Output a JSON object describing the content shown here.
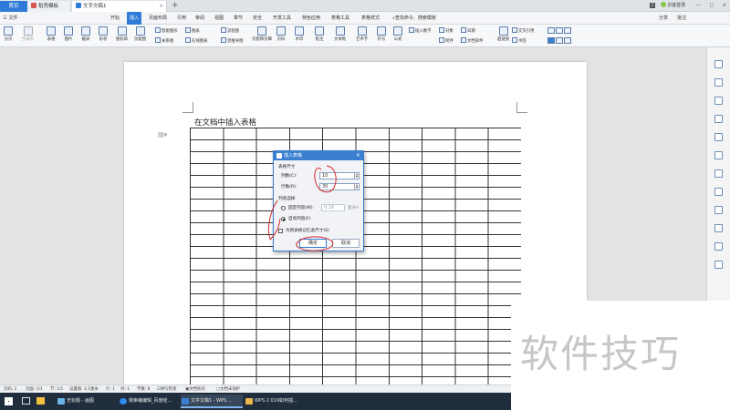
{
  "tabs": [
    {
      "label": "首页"
    },
    {
      "label": "稻壳模板"
    },
    {
      "label": "文字文稿1"
    }
  ],
  "window": {
    "new_tab": "+",
    "login": "访客登录",
    "icon_badge": "1"
  },
  "menu": {
    "file": "三 文件",
    "items": [
      "开始",
      "插入",
      "页面布局",
      "引用",
      "审阅",
      "视图",
      "章节",
      "安全",
      "开发工具",
      "特色应用",
      "表格工具",
      "表格样式"
    ],
    "search": "查找命令、搜索模板",
    "share": "分享",
    "comment": "批注"
  },
  "ribbon": {
    "large": [
      "分页",
      "空白页",
      "表格",
      "图片",
      "截屏",
      "形状",
      "图标库",
      "功能图",
      "页眉和页脚",
      "页码",
      "水印",
      "批注",
      "文本框",
      "艺术字",
      "符号",
      "公式",
      "超链接",
      "书签"
    ],
    "small": [
      "智能图形",
      "关系图",
      "图表",
      "在线图表",
      "流程图",
      "思维导图",
      "插入数字",
      "对象",
      "日期",
      "附件",
      "文档部件",
      "交叉引用"
    ]
  },
  "document": {
    "heading": "在文档中插入表格",
    "table_rows": 22,
    "table_cols": 10
  },
  "dialog": {
    "title": "插入表格",
    "close": "×",
    "size_section": "表格尺寸",
    "cols_label": "列数(C):",
    "cols_value": "10",
    "rows_label": "行数(R):",
    "rows_value": "30",
    "width_section": "列宽选择",
    "fixed_label": "固定列宽(W):",
    "fixed_value": "0.16",
    "fixed_unit": "厘米",
    "auto_label": "自动列宽(F)",
    "remember_label": "为新表格记忆此尺寸(S)",
    "ok": "确定",
    "cancel": "取消"
  },
  "status": {
    "page_num": "页码: 1",
    "pages": "页面: 1/1",
    "section": "节: 1/1",
    "position": "设置值: 3.1厘米",
    "row": "行: 1",
    "col": "列: 1",
    "words": "字数: 8",
    "spell": "拼写检查",
    "proofread": "文档校对",
    "protect": "文档未保护"
  },
  "taskbar": [
    {
      "label": "无标题 - 画图",
      "color": "#6bb3e8"
    },
    {
      "label": "我审编编辑_百度经…",
      "color": "#2d8cf0"
    },
    {
      "label": "文字文稿1 - WPS …",
      "color": "#3a7fd0",
      "active": true
    },
    {
      "label": "WPS 2 019如何插…",
      "color": "#e8b84a"
    }
  ],
  "watermark": "软件技巧",
  "colors": {
    "accent": "#2f7bd9",
    "annotation": "#d42a2a",
    "taskbar": "#1f2d3d"
  }
}
